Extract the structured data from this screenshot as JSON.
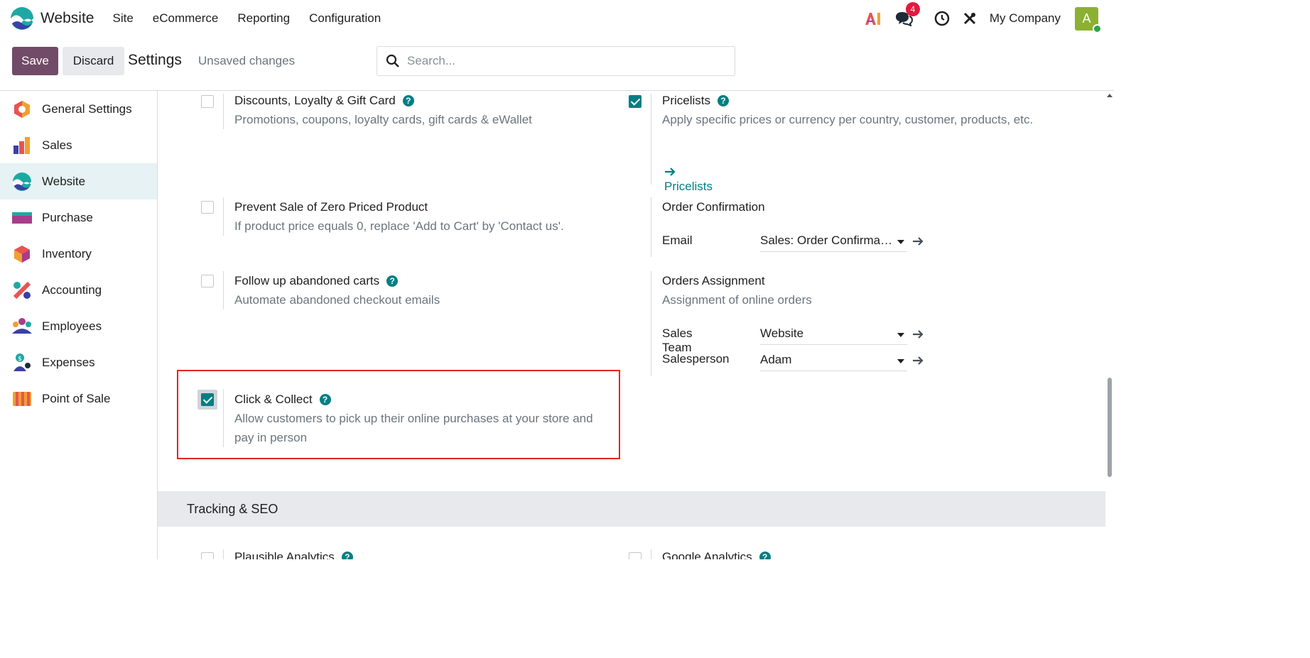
{
  "app": {
    "name": "Website"
  },
  "nav": {
    "menu": [
      "Site",
      "eCommerce",
      "Reporting",
      "Configuration"
    ],
    "ai_label": "AI",
    "messages_count": "4",
    "company": "My Company",
    "avatar_letter": "A"
  },
  "controls": {
    "save_label": "Save",
    "discard_label": "Discard",
    "title": "Settings",
    "status": "Unsaved changes",
    "search_placeholder": "Search..."
  },
  "sidebar": {
    "items": [
      {
        "label": "General Settings"
      },
      {
        "label": "Sales"
      },
      {
        "label": "Website"
      },
      {
        "label": "Purchase"
      },
      {
        "label": "Inventory"
      },
      {
        "label": "Accounting"
      },
      {
        "label": "Employees"
      },
      {
        "label": "Expenses"
      },
      {
        "label": "Point of Sale"
      }
    ],
    "active_index": 2
  },
  "settings": {
    "discounts": {
      "title": "Discounts, Loyalty & Gift Card",
      "desc": "Promotions, coupons, loyalty cards, gift cards & eWallet",
      "checked": false
    },
    "pricelists": {
      "title": "Pricelists",
      "desc": "Apply specific prices or currency per country, customer, products, etc.",
      "checked": true,
      "link": "Pricelists"
    },
    "zero_price": {
      "title": "Prevent Sale of Zero Priced Product",
      "desc": "If product price equals 0, replace 'Add to Cart' by 'Contact us'.",
      "checked": false
    },
    "order_confirmation": {
      "title": "Order Confirmation",
      "email_label": "Email",
      "email_value": "Sales: Order Confirmation"
    },
    "abandoned": {
      "title": "Follow up abandoned carts",
      "desc": "Automate abandoned checkout emails",
      "checked": false
    },
    "orders_assignment": {
      "title": "Orders Assignment",
      "desc": "Assignment of online orders",
      "team_label": "Sales Team",
      "team_value": "Website",
      "person_label": "Salesperson",
      "person_value": "Adam"
    },
    "click_collect": {
      "title": "Click & Collect",
      "desc": "Allow customers to pick up their online purchases at your store and pay in person",
      "checked": true
    },
    "plausible": {
      "title": "Plausible Analytics",
      "checked": false
    },
    "google": {
      "title": "Google Analytics",
      "checked": false
    }
  },
  "sections": {
    "tracking": "Tracking & SEO"
  },
  "colors": {
    "primary": "#714b67",
    "accent": "#017e84",
    "highlight": "#e02424"
  }
}
